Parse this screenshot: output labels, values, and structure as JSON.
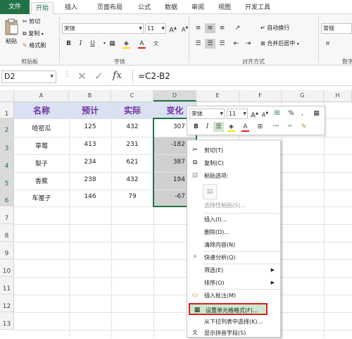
{
  "tabs": [
    "文件",
    "开始",
    "插入",
    "页面布局",
    "公式",
    "数据",
    "审阅",
    "视图",
    "开发工具"
  ],
  "ribbon": {
    "paste": "粘贴",
    "cut": "剪切",
    "copy": "复制",
    "format_painter": "格式刷",
    "clipboard_group": "剪贴板",
    "font_name": "宋体",
    "font_size": "11",
    "font_group": "字体",
    "wrap_text": "自动换行",
    "merge_center": "合并后居中",
    "align_group": "对齐方式",
    "number_format": "常规",
    "number_group": "数字",
    "bold": "B",
    "italic": "I",
    "underline": "U",
    "font_color_letter": "A",
    "grow_font": "A",
    "shrink_font": "A"
  },
  "formula_bar": {
    "name_box": "D2",
    "fx": "fx",
    "formula": "=C2-B2"
  },
  "columns": [
    "A",
    "B",
    "C",
    "D",
    "E",
    "F",
    "G",
    "H"
  ],
  "rows": [
    "1",
    "2",
    "3",
    "4",
    "5",
    "6",
    "7",
    "8",
    "9",
    "10",
    "11",
    "12",
    "13"
  ],
  "table": {
    "headers": [
      "名称",
      "预计",
      "实际",
      "变化"
    ],
    "rows": [
      [
        "哈密瓜",
        "125",
        "432",
        "307"
      ],
      [
        "草莓",
        "413",
        "231",
        "-182"
      ],
      [
        "梨子",
        "234",
        "621",
        "387"
      ],
      [
        "香蕉",
        "238",
        "432",
        "194"
      ],
      [
        "车厘子",
        "146",
        "79",
        "-67"
      ]
    ]
  },
  "mini_toolbar": {
    "font_name": "宋体",
    "font_size": "11",
    "bold": "B",
    "italic": "I",
    "percent": "%",
    "comma": ","
  },
  "context_menu": {
    "cut": "剪切(T)",
    "copy": "复制(C)",
    "paste_options": "粘贴选项:",
    "paste_special": "选择性粘贴(S)...",
    "insert": "插入(I)...",
    "delete": "删除(D)...",
    "clear": "清除内容(N)",
    "quick_analysis": "快速分析(Q)",
    "filter": "筛选(E)",
    "sort": "排序(O)",
    "insert_comment": "插入批注(M)",
    "format_cells": "设置单元格格式(F)...",
    "pick_list": "从下拉列表中选择(K)...",
    "phonetic": "显示拼音字段(S)"
  },
  "colors": {
    "excel_green": "#217346",
    "header_purple": "#7030a0",
    "highlight_red": "#e02020",
    "selection_gray": "#d0d0d0"
  }
}
